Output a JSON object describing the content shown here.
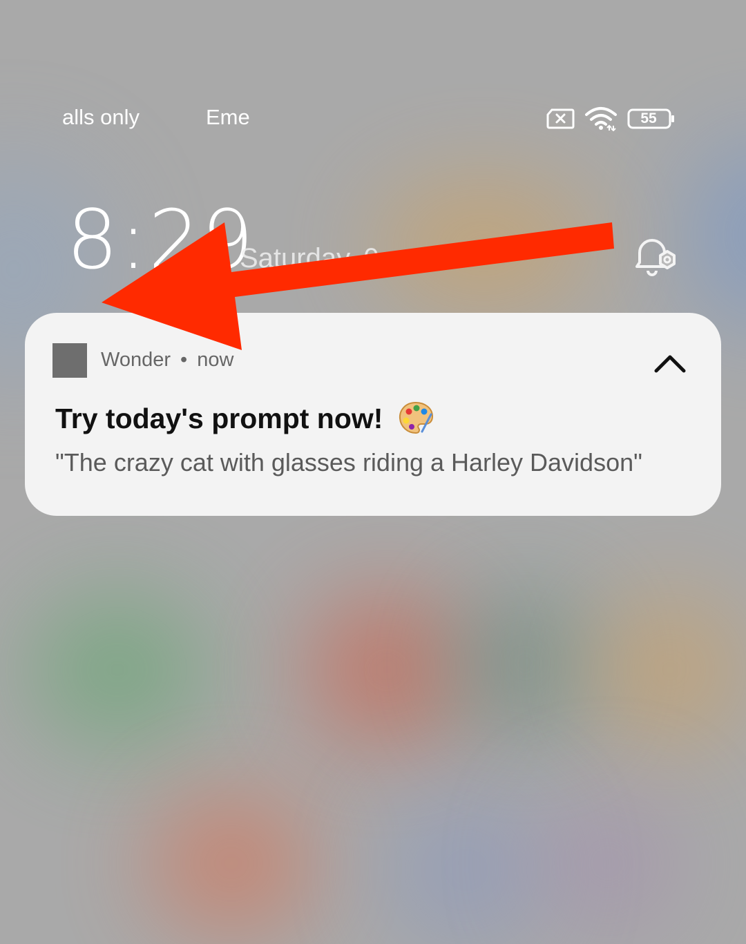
{
  "status_bar": {
    "left_items": [
      "alls only",
      "Eme"
    ],
    "battery_level": "55",
    "icons": [
      "sim-error-icon",
      "wifi-icon",
      "battery-icon"
    ]
  },
  "lock_screen": {
    "time": "8:29",
    "date": "Saturday, 0",
    "alarm_icon": "alarm-settings-icon"
  },
  "notification": {
    "app_name": "Wonder",
    "separator": "•",
    "time": "now",
    "title": "Try today's prompt now!",
    "title_emoji_icon": "palette-icon",
    "body": "\"The crazy cat with glasses riding a Harley Davidson\"",
    "collapse_icon": "chevron-up-icon"
  },
  "annotation": {
    "color": "#ff2a00",
    "shape": "arrow-pointing-left"
  }
}
